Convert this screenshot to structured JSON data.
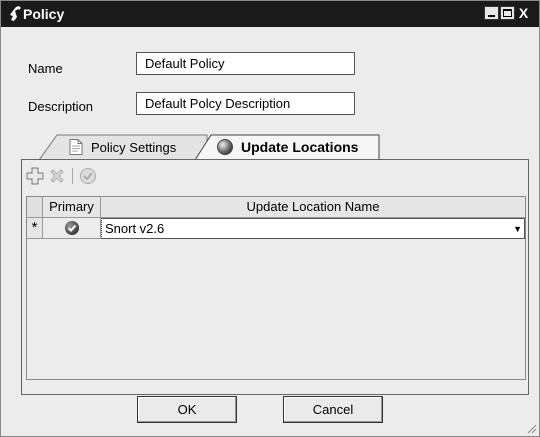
{
  "window": {
    "title": "Policy",
    "close_glyph": "X"
  },
  "form": {
    "name_label": "Name",
    "name_value": "Default Policy",
    "description_label": "Description",
    "description_value": "Default Polcy Description"
  },
  "tabs": [
    {
      "label": "Policy Settings",
      "icon": "document-icon",
      "active": false
    },
    {
      "label": "Update Locations",
      "icon": "globe-icon",
      "active": true
    }
  ],
  "toolbar": {
    "items": [
      {
        "name": "add-icon",
        "enabled": true
      },
      {
        "name": "delete-icon",
        "enabled": false
      },
      {
        "name": "check-icon",
        "enabled": false
      }
    ]
  },
  "grid": {
    "columns": [
      "Primary",
      "Update Location Name"
    ],
    "rows": [
      {
        "row_marker": "*",
        "primary": true,
        "location": "Snort v2.6",
        "dropdown_glyph": "▼"
      }
    ]
  },
  "buttons": {
    "ok": "OK",
    "cancel": "Cancel"
  },
  "colors": {
    "titlebar": "#1a1a1a",
    "window_bg": "#ececec"
  }
}
